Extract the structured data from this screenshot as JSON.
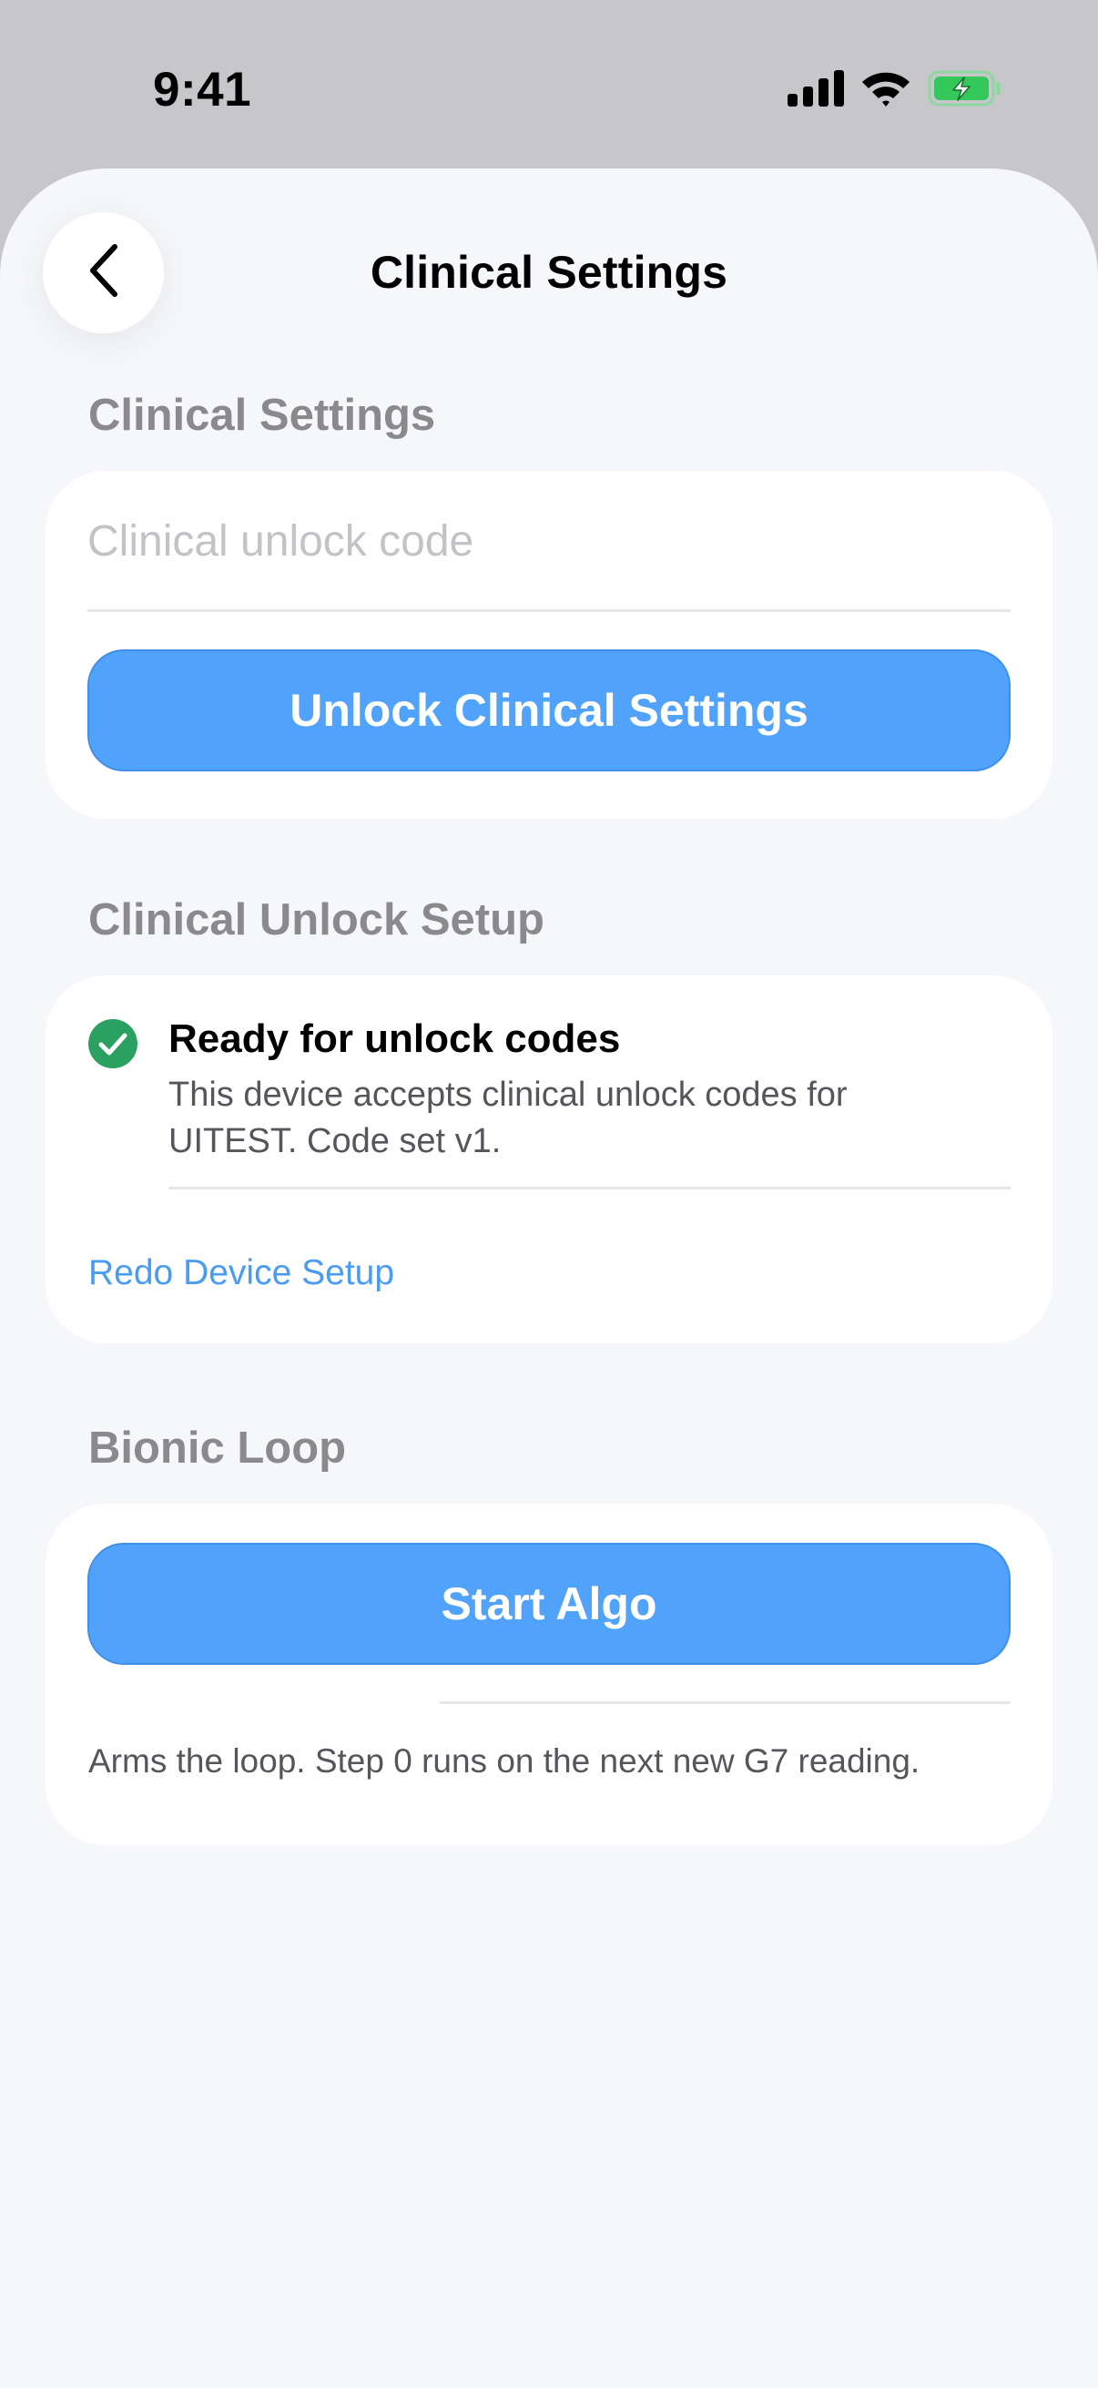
{
  "status_bar": {
    "time": "9:41",
    "icons": [
      "cellular-signal-icon",
      "wifi-icon",
      "battery-charging-icon"
    ],
    "battery_color": "#34c759"
  },
  "nav": {
    "back_icon": "chevron-left-icon",
    "title": "Clinical Settings"
  },
  "clinical_settings": {
    "header": "Clinical Settings",
    "input_placeholder": "Clinical unlock code",
    "input_value": "",
    "unlock_button_label": "Unlock Clinical Settings"
  },
  "unlock_setup": {
    "header": "Clinical Unlock Setup",
    "status_icon": "checkmark-circle-icon",
    "status_color": "#2aa160",
    "status_title": "Ready for unlock codes",
    "status_description": "This device accepts clinical unlock codes for UITEST. Code set v1.",
    "redo_link_label": "Redo Device Setup"
  },
  "bionic_loop": {
    "header": "Bionic Loop",
    "start_button_label": "Start Algo",
    "footnote": "Arms the loop. Step 0 runs on the next new G7 reading."
  },
  "colors": {
    "accent": "#51a2fa",
    "link": "#4a9cf2",
    "background": "#f6f7fb",
    "section_header": "#8a8a8e"
  }
}
